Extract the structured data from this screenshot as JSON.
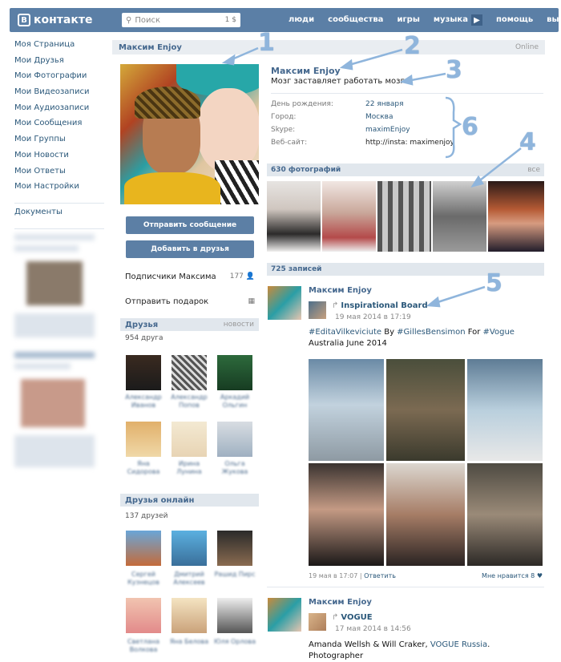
{
  "topbar": {
    "logo": "контакте",
    "logo_mark": "В",
    "search_placeholder": "Поиск",
    "search_count": "1 $",
    "nav": [
      "люди",
      "сообщества",
      "игры",
      "музыка",
      "помощь",
      "выйти"
    ],
    "colors": {
      "bar": "#5b7fa6",
      "link": "#2b587a"
    }
  },
  "leftnav": {
    "items": [
      "Моя Страница",
      "Мои Друзья",
      "Мои Фотографии",
      "Мои Видеозаписи",
      "Мои Аудиозаписи",
      "Мои Сообщения",
      "Мои Группы",
      "Мои Новости",
      "Мои Ответы",
      "Мои Настройки"
    ],
    "documents": "Документы"
  },
  "profile": {
    "header_name": "Максим Enjoy",
    "online": "Online",
    "name": "Максим Enjoy",
    "status": "Мозг заставляет работать мозг.",
    "info": [
      {
        "k": "День рождения:",
        "v": "22 января"
      },
      {
        "k": "Город:",
        "v": "Москва"
      },
      {
        "k": "Skype:",
        "v": "maximEnjoy"
      },
      {
        "k": "Веб-сайт:",
        "v": "http://insta: maximenjoy"
      }
    ],
    "send_message": "Отправить сообщение",
    "add_friend": "Добавить в друзья",
    "subscribers": "Подписчики Максима",
    "subscribers_count": "177",
    "send_gift": "Отправить подарок"
  },
  "friends": {
    "title": "Друзья",
    "right": "новости",
    "count": "954 друга",
    "names": [
      "Александр Иванов",
      "Александр Попов",
      "Аркадий Ольгин",
      "Яна Сидорова",
      "Ирина Лунина",
      "Ольга Жукова"
    ]
  },
  "friends_online": {
    "title": "Друзья онлайн",
    "count": "137 друзей",
    "names": [
      "Сергей Кузнецов",
      "Дмитрий Алексеев",
      "Рашид Пирс",
      "Светлана Волкова",
      "Яна Белова",
      "Юля Орлова"
    ]
  },
  "photos": {
    "title": "630 фотографий",
    "right": "все"
  },
  "wall": {
    "title": "725 записей",
    "posts": [
      {
        "author": "Максим Enjoy",
        "repost": "Inspirational Board",
        "date": "19 мая 2014 в 17:19",
        "text_plain": "#EditaVilkeviciute By #GillesBensimon For #Vogue Australia June 2014",
        "footer_left": "19 мая в 17:07",
        "footer_reply": "Ответить",
        "footer_right": "Мне нравится  8"
      },
      {
        "author": "Максим Enjoy",
        "repost": "VOGUE",
        "date": "17 мая 2014 в 14:56",
        "text_plain": "Amanda Wellsh & Will Craker, VOGUE Russia. Photographer"
      }
    ]
  },
  "annotations": [
    "1",
    "2",
    "3",
    "4",
    "5",
    "6"
  ]
}
